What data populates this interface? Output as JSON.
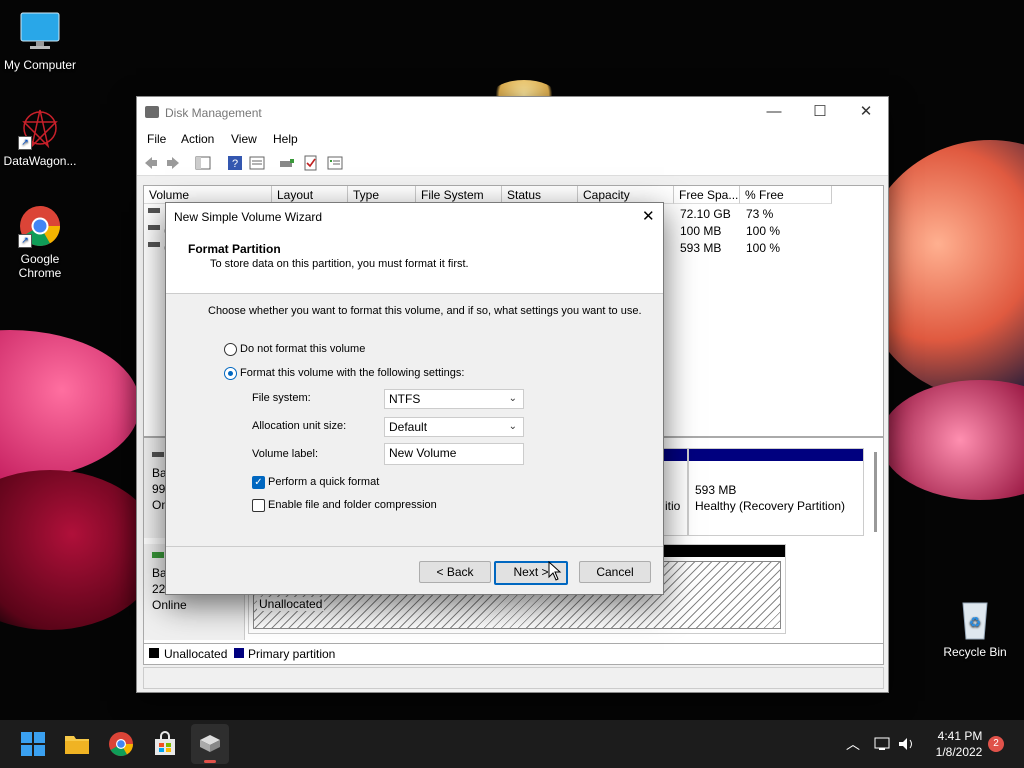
{
  "desktop": {
    "icons": [
      {
        "label": "My Computer",
        "icon": "monitor-icon"
      },
      {
        "label": "DataWagon...",
        "icon": "datawagon-icon"
      },
      {
        "label": "Google Chrome",
        "icon": "chrome-icon"
      },
      {
        "label": "Recycle Bin",
        "icon": "recycle-bin-icon"
      }
    ]
  },
  "window": {
    "title": "Disk Management",
    "menu": [
      "File",
      "Action",
      "View",
      "Help"
    ],
    "columns": [
      "Volume",
      "Layout",
      "Type",
      "File System",
      "Status",
      "Capacity",
      "Free Spa...",
      "% Free"
    ],
    "rows": [
      {
        "volume": "",
        "free": "72.10 GB",
        "pct": "73 %"
      },
      {
        "volume": "(",
        "free": "100 MB",
        "pct": "100 %"
      },
      {
        "volume": "(",
        "free": "593 MB",
        "pct": "100 %"
      }
    ],
    "disk0": {
      "label_line1": "Bas",
      "label_line2": "99.",
      "label_line3": "Onl",
      "recovery_size": "593 MB",
      "recovery_status": "Healthy (Recovery Partition)",
      "partial_text": "itio"
    },
    "disk1": {
      "label_line1": "Bas",
      "label_line2": "22.",
      "label_line3": "Online",
      "unallocated": "Unallocated"
    },
    "legend": [
      "Unallocated",
      "Primary partition"
    ]
  },
  "dialog": {
    "title": "New Simple Volume Wizard",
    "heading": "Format Partition",
    "subheading": "To store data on this partition, you must format it first.",
    "instruction": "Choose whether you want to format this volume, and if so, what settings you want to use.",
    "radio_no_format": "Do not format this volume",
    "radio_format": "Format this volume with the following settings:",
    "file_system_label": "File system:",
    "file_system_value": "NTFS",
    "alloc_label": "Allocation unit size:",
    "alloc_value": "Default",
    "volume_label_label": "Volume label:",
    "volume_label_value": "New Volume",
    "quick_format": "Perform a quick format",
    "compression": "Enable file and folder compression",
    "back": "< Back",
    "next": "Next >",
    "cancel": "Cancel"
  },
  "taskbar": {
    "time": "4:41 PM",
    "date": "1/8/2022",
    "notifications": "2"
  },
  "colors": {
    "accent": "#0067c0",
    "primary_partition": "#00007f",
    "taskbar": "#1c1c1c"
  }
}
